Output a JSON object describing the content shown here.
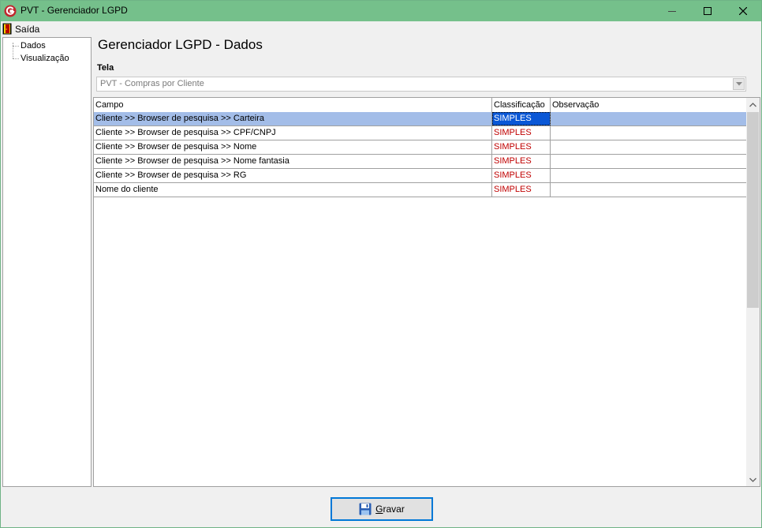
{
  "window": {
    "title": "PVT - Gerenciador LGPD",
    "accent": "#75c08b"
  },
  "menu": {
    "items": [
      {
        "label": "Saída",
        "icon": "exit-door-icon"
      }
    ]
  },
  "tree": {
    "items": [
      {
        "label": "Dados"
      },
      {
        "label": "Visualização"
      }
    ]
  },
  "main": {
    "heading": "Gerenciador LGPD - Dados",
    "tela_label": "Tela",
    "tela_value": "PVT - Compras por Cliente"
  },
  "grid": {
    "columns": [
      "Campo",
      "Classificação",
      "Observação"
    ],
    "rows": [
      {
        "campo": "Cliente >> Browser de pesquisa >> Carteira",
        "classificacao": "SIMPLES",
        "observacao": "",
        "selected": true
      },
      {
        "campo": "Cliente >> Browser de pesquisa >> CPF/CNPJ",
        "classificacao": "SIMPLES",
        "observacao": ""
      },
      {
        "campo": "Cliente >> Browser de pesquisa >> Nome",
        "classificacao": "SIMPLES",
        "observacao": ""
      },
      {
        "campo": "Cliente >> Browser de pesquisa >> Nome fantasia",
        "classificacao": "SIMPLES",
        "observacao": ""
      },
      {
        "campo": "Cliente >> Browser de pesquisa >> RG",
        "classificacao": "SIMPLES",
        "observacao": ""
      },
      {
        "campo": "Nome do cliente",
        "classificacao": "SIMPLES",
        "observacao": ""
      }
    ],
    "colors": {
      "selected_row": "#a3bde8",
      "selected_cell": "#0a57d6",
      "classification_text": "#c00000"
    }
  },
  "footer": {
    "save_label_prefix": "G",
    "save_label_rest": "ravar",
    "save_icon": "floppy-disk-icon"
  }
}
